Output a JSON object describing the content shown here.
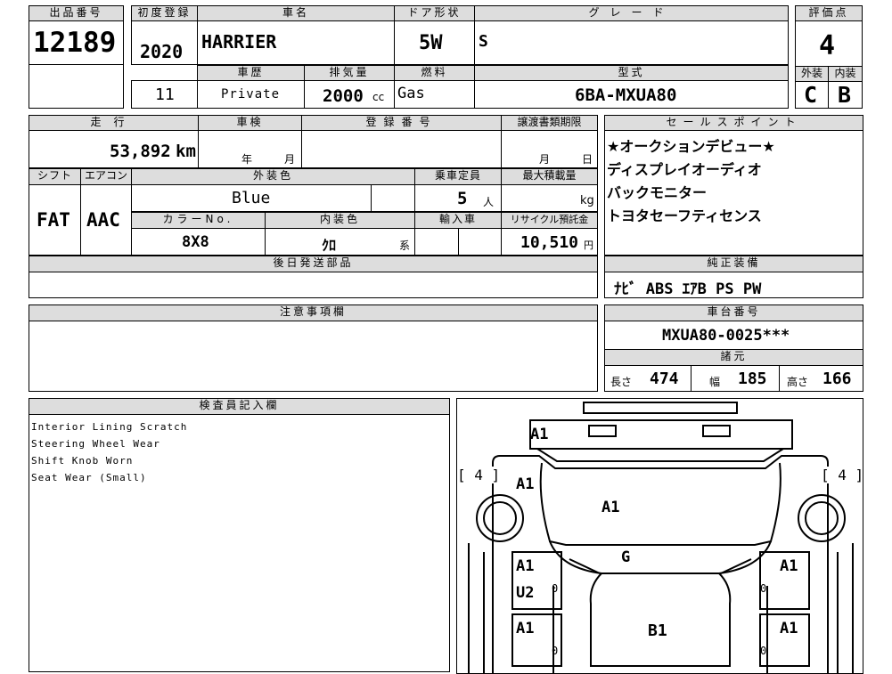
{
  "header": {
    "lot_no": {
      "label": "出品番号",
      "value": "12189"
    },
    "first_reg": {
      "label": "初度登録",
      "value": "2020"
    },
    "car_name": {
      "label": "車名",
      "value": "HARRIER"
    },
    "door": {
      "label": "ドア形状",
      "value": "5W"
    },
    "grade": {
      "label": "グレード",
      "value": "S"
    },
    "score": {
      "label": "評価点",
      "value": "4"
    },
    "history": {
      "label": "車歴",
      "value": "Private"
    },
    "reg_year_count": "11",
    "displacement": {
      "label": "排気量",
      "value": "2000",
      "unit": "cc"
    },
    "fuel": {
      "label": "燃料",
      "value": "Gas"
    },
    "model_type": {
      "label": "型式",
      "value": "6BA-MXUA80"
    },
    "exterior_grade": {
      "label": "外装",
      "value": "C"
    },
    "interior_grade": {
      "label": "内装",
      "value": "B"
    }
  },
  "details": {
    "mileage": {
      "label": "走行",
      "value": "53,892",
      "unit": "km"
    },
    "inspection": {
      "label": "車検",
      "year_unit": "年",
      "month_unit": "月"
    },
    "reg_number": {
      "label": "登録番号"
    },
    "transfer_deadline": {
      "label": "譲渡書類期限",
      "month_unit": "月",
      "day_unit": "日"
    },
    "shift": {
      "label": "シフト",
      "value": "FAT"
    },
    "aircon": {
      "label": "エアコン",
      "value": "AAC"
    },
    "ext_color": {
      "label": "外装色",
      "value": "Blue"
    },
    "capacity": {
      "label": "乗車定員",
      "value": "5",
      "unit": "人"
    },
    "max_load": {
      "label": "最大積載量",
      "unit": "kg"
    },
    "color_no": {
      "label": "カラーNo.",
      "value": "8X8"
    },
    "int_color": {
      "label": "内装色",
      "value": "ｸﾛ",
      "suffix": "系"
    },
    "import": {
      "label": "輸入車"
    },
    "recycle": {
      "label": "リサイクル預託金",
      "value": "10,510",
      "unit": "円"
    },
    "later_parts": {
      "label": "後日発送部品"
    }
  },
  "sales_points": {
    "label": "セールスポイント",
    "items": [
      "★オークションデビュー★",
      "ディスプレイオーディオ",
      "バックモニター",
      "トヨタセーフティセンス"
    ]
  },
  "equipment": {
    "label": "純正装備",
    "value": "ﾅﾋﾞ ABS ｴｱB PS PW"
  },
  "caution": {
    "label": "注意事項欄"
  },
  "chassis": {
    "label": "車台番号",
    "value": "MXUA80-0025***"
  },
  "specs": {
    "label": "諸元",
    "length": {
      "label": "長さ",
      "value": "474"
    },
    "width": {
      "label": "幅",
      "value": "185"
    },
    "height": {
      "label": "高さ",
      "value": "166"
    }
  },
  "inspector": {
    "label": "検査員記入欄",
    "notes": [
      "Interior Lining Scratch",
      "Steering Wheel Wear",
      "Shift Knob Worn",
      "Seat Wear (Small)"
    ]
  },
  "diagram": {
    "marks": {
      "rear": "A1",
      "left_top": "A1",
      "hatch": "A1",
      "glass": "G",
      "left_mid1": "A1",
      "left_mid2": "U2",
      "right_mid1": "A1",
      "left_low": "A1",
      "roof": "B1",
      "right_low": "A1"
    },
    "tire_left": "[ 4 ]",
    "tire_right": "[ 4 ]",
    "zero": "0"
  }
}
